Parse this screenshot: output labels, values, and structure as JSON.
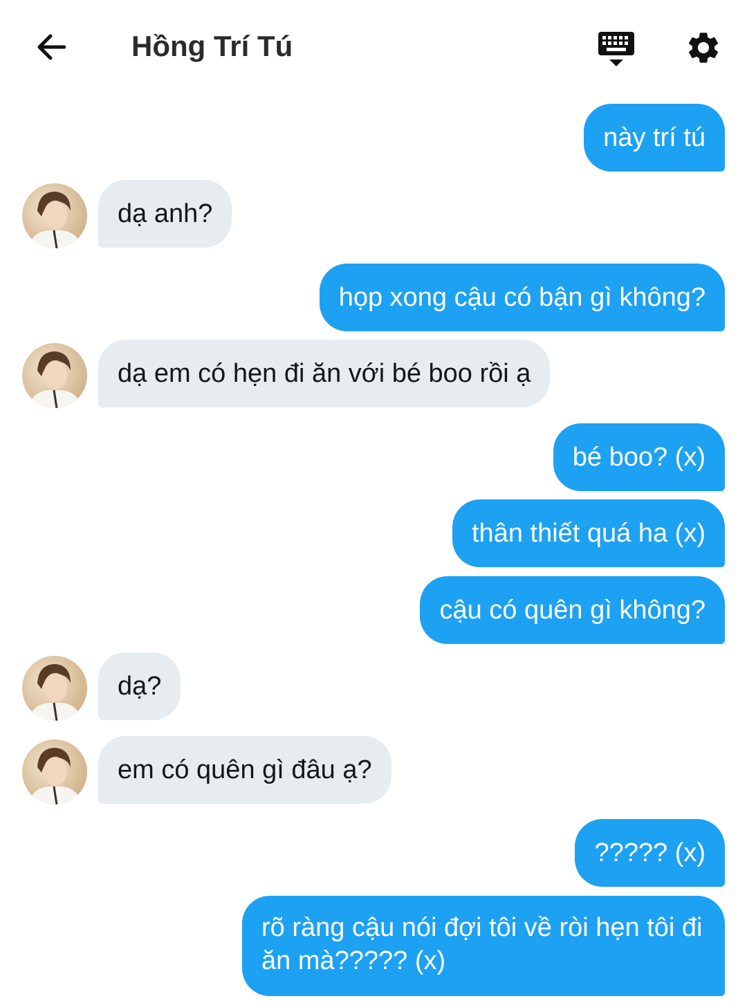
{
  "header": {
    "title": "Hồng Trí Tú",
    "back_icon": "arrow-left-icon",
    "keyboard_icon": "keyboard-hide-icon",
    "settings_icon": "gear-icon"
  },
  "colors": {
    "outgoing_bubble": "#1da1f2",
    "incoming_bubble": "#e6ecf0",
    "outgoing_text": "#ffffff",
    "incoming_text": "#14171a"
  },
  "messages": [
    {
      "side": "out",
      "text": "này trí tú"
    },
    {
      "side": "in",
      "text": "dạ anh?"
    },
    {
      "side": "out",
      "text": "họp xong cậu có bận gì không?"
    },
    {
      "side": "in",
      "text": "dạ em có hẹn đi ăn với bé boo rồi ạ"
    },
    {
      "side": "out",
      "text": "bé boo? (x)"
    },
    {
      "side": "out",
      "text": "thân thiết quá ha (x)"
    },
    {
      "side": "out",
      "text": "cậu có quên gì không?"
    },
    {
      "side": "in",
      "text": "dạ?"
    },
    {
      "side": "in",
      "text": "em có quên gì đâu ạ?"
    },
    {
      "side": "out",
      "text": "????? (x)"
    },
    {
      "side": "out",
      "text": "rõ ràng cậu nói đợi tôi về ròi hẹn tôi đi ăn mà????? (x)"
    }
  ]
}
